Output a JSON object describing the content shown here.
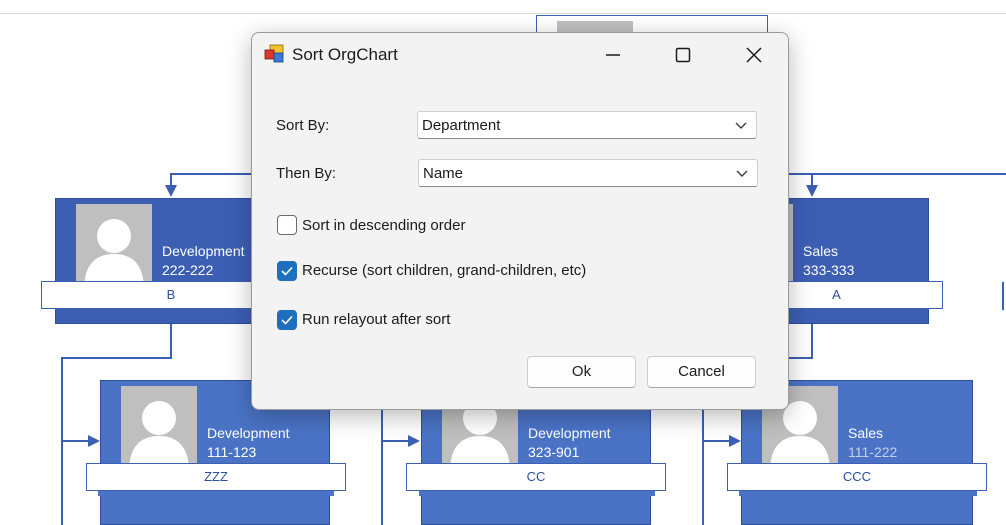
{
  "colors": {
    "card": "#3d5fb3",
    "card_light": "#4a73c6",
    "accent": "#1f6fbf"
  },
  "orgchart": {
    "cards": [
      {
        "department": "Development",
        "phone": "222-222",
        "name": "B"
      },
      {
        "department": "Sales",
        "phone": "333-333",
        "name": "A"
      },
      {
        "department": "Development",
        "phone": "111-123",
        "name": "ZZZ"
      },
      {
        "department": "Development",
        "phone": "323-901",
        "name": "CC"
      },
      {
        "department": "Sales",
        "phone": "111-222",
        "name": "CCC"
      }
    ]
  },
  "dialog": {
    "title": "Sort OrgChart",
    "controls": {
      "minimize": "minimize-icon",
      "maximize": "maximize-icon",
      "close": "close-icon"
    },
    "sort_by": {
      "label": "Sort By:",
      "value": "Department"
    },
    "then_by": {
      "label": "Then By:",
      "value": "Name"
    },
    "options": [
      {
        "label": "Sort in descending order",
        "checked": false
      },
      {
        "label": "Recurse (sort children, grand-children, etc)",
        "checked": true
      },
      {
        "label": "Run relayout after sort",
        "checked": true
      }
    ],
    "ok_label": "Ok",
    "cancel_label": "Cancel"
  }
}
